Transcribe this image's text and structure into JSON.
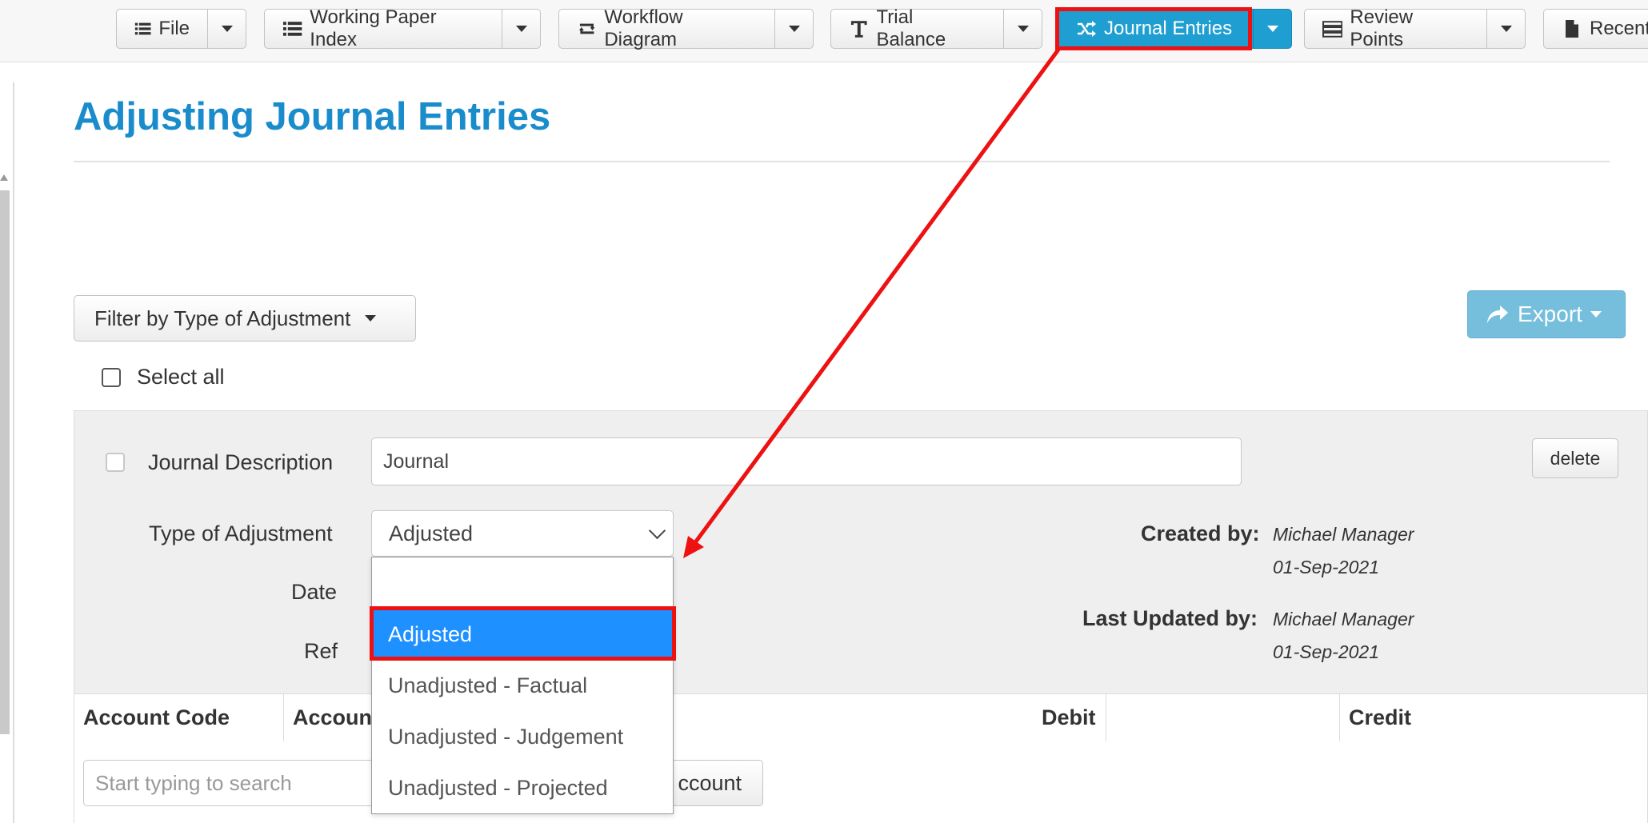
{
  "toolbar": {
    "buttons": [
      {
        "label": "File",
        "icon": "list-icon"
      },
      {
        "label": "Working Paper Index",
        "icon": "list-icon"
      },
      {
        "label": "Workflow Diagram",
        "icon": "workflow-icon"
      },
      {
        "label": "Trial Balance",
        "icon": "text-t-icon"
      },
      {
        "label": "Journal Entries",
        "icon": "shuffle-icon",
        "active": true
      },
      {
        "label": "Review Points",
        "icon": "stack-icon"
      },
      {
        "label": "Recent",
        "icon": "file-icon"
      }
    ]
  },
  "page": {
    "title": "Adjusting Journal Entries"
  },
  "filter": {
    "label": "Filter by Type of Adjustment"
  },
  "export": {
    "label": "Export"
  },
  "select_all": {
    "label": "Select all"
  },
  "journal": {
    "description_label": "Journal Description",
    "description_value": "Journal",
    "delete_label": "delete",
    "type_label": "Type of Adjustment",
    "type_value": "Adjusted",
    "date_label": "Date",
    "ref_label": "Ref",
    "created_by_label": "Created by:",
    "created_by_name": "Michael Manager",
    "created_date": "01-Sep-2021",
    "updated_by_label": "Last Updated by:",
    "updated_by_name": "Michael Manager",
    "updated_date": "01-Sep-2021"
  },
  "table": {
    "columns": [
      "Account Code",
      "Accoun",
      "Debit",
      "Credit"
    ],
    "search_placeholder": "Start typing to search",
    "add_account_label": "ccount"
  },
  "type_dropdown": {
    "options": [
      "",
      "Adjusted",
      "Unadjusted - Factual",
      "Unadjusted - Judgement",
      "Unadjusted - Projected"
    ],
    "selected": "Adjusted"
  },
  "colors": {
    "title_blue": "#1a8ccc",
    "primary_button": "#1f9fd1",
    "export_button": "#75bfdc",
    "highlight_red": "#ee1111",
    "selected_option": "#1e90ff"
  }
}
